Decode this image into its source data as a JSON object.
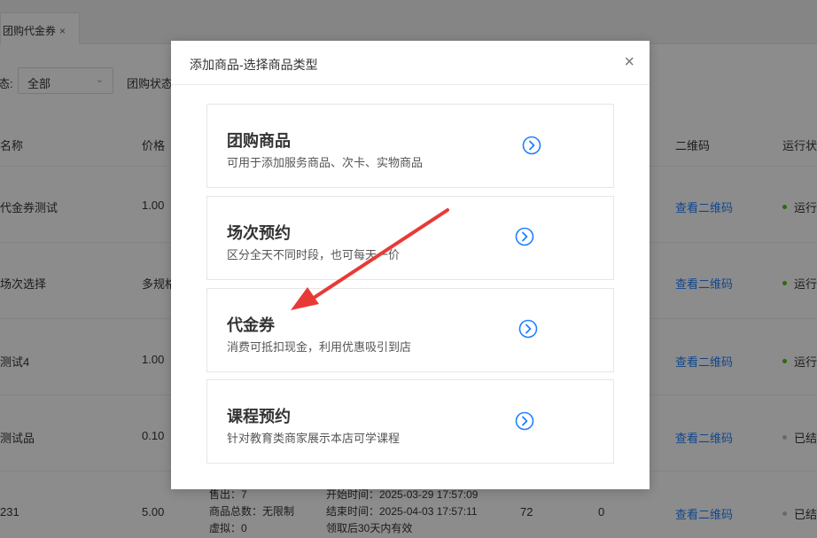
{
  "tab": {
    "label": "团购代金券",
    "close": "×"
  },
  "filters": {
    "status_label_partial": "态:",
    "select_value": "全部",
    "group_status_label": "团购状态"
  },
  "table": {
    "headers": {
      "name": "名称",
      "price": "价格",
      "qrcode": "二维码",
      "run_status": "运行状"
    },
    "rows": [
      {
        "name": "代金券测试",
        "price": "1.00",
        "qrcode": "查看二维码",
        "status": "运行",
        "status_color": "#52c41a"
      },
      {
        "name": "场次选择",
        "price": "多规格",
        "qrcode": "查看二维码",
        "status": "运行",
        "status_color": "#52c41a"
      },
      {
        "name": "测试4",
        "price": "1.00",
        "qrcode": "查看二维码",
        "status": "运行",
        "status_color": "#52c41a"
      },
      {
        "name": "测试品",
        "price": "0.10",
        "qrcode": "查看二维码",
        "status": "已结",
        "status_color": "#c0c0c0"
      },
      {
        "name": "231",
        "price": "5.00",
        "qrcode": "查看二维码",
        "status": "已结",
        "status_color": "#c0c0c0",
        "stats": [
          "售出：7",
          "商品总数：无限制",
          "虚拟：0"
        ],
        "times": [
          "开始时间：2025-03-29 17:57:09",
          "结束时间：2025-04-03 17:57:11",
          "领取后30天内有效"
        ],
        "num1": "72",
        "num2": "0"
      }
    ]
  },
  "modal": {
    "title": "添加商品-选择商品类型",
    "close": "×",
    "options": [
      {
        "title": "团购商品",
        "desc": "可用于添加服务商品、次卡、实物商品",
        "icon": "chevron-right-circle-icon"
      },
      {
        "title": "场次预约",
        "desc": "区分全天不同时段，也可每天一价",
        "icon": "chevron-right-circle-icon"
      },
      {
        "title": "代金券",
        "desc": "消费可抵扣现金，利用优惠吸引到店",
        "icon": "chevron-right-circle-icon"
      },
      {
        "title": "课程预约",
        "desc": "针对教育类商家展示本店可学课程",
        "icon": "chevron-right-circle-icon"
      }
    ]
  },
  "colors": {
    "accent": "#1e80ff",
    "annotation_arrow": "#e83a35"
  }
}
